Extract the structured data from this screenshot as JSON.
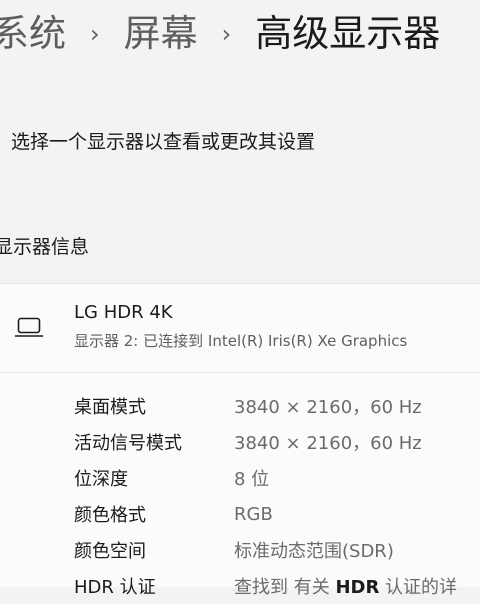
{
  "breadcrumb": {
    "items": [
      "系统",
      "屏幕"
    ],
    "current": "高级显示器"
  },
  "selector": {
    "label": "选择一个显示器以查看或更改其设置"
  },
  "section": {
    "title": "显示器信息"
  },
  "display": {
    "icon": "laptop-icon",
    "name": "LG HDR 4K",
    "subtitle": "显示器 2: 已连接到 Intel(R) Iris(R) Xe Graphics"
  },
  "info_rows": [
    {
      "label": "桌面模式",
      "value": "3840 × 2160，60 Hz"
    },
    {
      "label": "活动信号模式",
      "value": "3840 × 2160，60 Hz"
    },
    {
      "label": "位深度",
      "value": "8 位"
    },
    {
      "label": "颜色格式",
      "value": "RGB"
    },
    {
      "label": "颜色空间",
      "value": "标准动态范围(SDR)"
    },
    {
      "label": "HDR 认证",
      "value_prefix": "查找到 有关 ",
      "value_bold": "HDR",
      "value_suffix": " 认证的详"
    }
  ],
  "colors": {
    "background": "#f3f3f3",
    "card": "#fbfbfb",
    "text_primary": "#1b1b1b",
    "text_secondary": "#6b6b6b"
  }
}
